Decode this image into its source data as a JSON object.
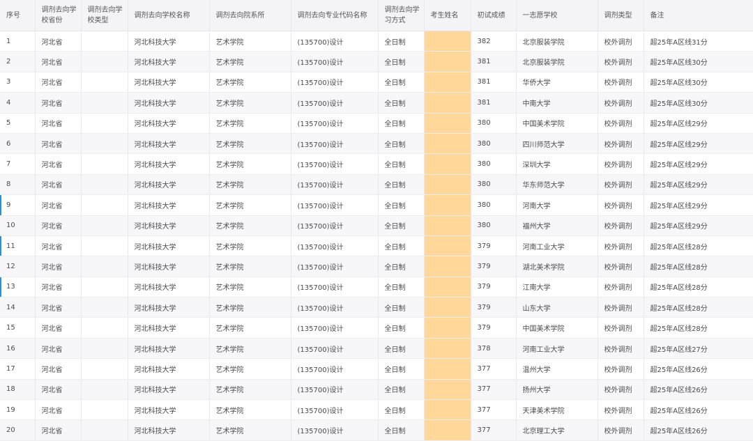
{
  "headers": {
    "idx": "序号",
    "province": "调剂去向学校省份",
    "school_type": "调剂去向学校类型",
    "school": "调剂去向学校名称",
    "dept": "调剂去向院系所",
    "major": "调剂去向专业代码名称",
    "mode": "调剂去向学习方式",
    "name": "考生姓名",
    "score": "初试成绩",
    "first_choice": "一志愿学校",
    "adjust_type": "调剂类型",
    "note": "备注"
  },
  "rows": [
    {
      "idx": "1",
      "province": "河北省",
      "school_type": "",
      "school": "河北科技大学",
      "dept": "艺术学院",
      "major": "(135700)设计",
      "mode": "全日制",
      "name": "",
      "score": "382",
      "first_choice": "北京服装学院",
      "adjust_type": "校外调剂",
      "note": "超25年A区线31分"
    },
    {
      "idx": "2",
      "province": "河北省",
      "school_type": "",
      "school": "河北科技大学",
      "dept": "艺术学院",
      "major": "(135700)设计",
      "mode": "全日制",
      "name": "",
      "score": "381",
      "first_choice": "北京服装学院",
      "adjust_type": "校外调剂",
      "note": "超25年A区线30分"
    },
    {
      "idx": "3",
      "province": "河北省",
      "school_type": "",
      "school": "河北科技大学",
      "dept": "艺术学院",
      "major": "(135700)设计",
      "mode": "全日制",
      "name": "",
      "score": "381",
      "first_choice": "华侨大学",
      "adjust_type": "校外调剂",
      "note": "超25年A区线30分"
    },
    {
      "idx": "4",
      "province": "河北省",
      "school_type": "",
      "school": "河北科技大学",
      "dept": "艺术学院",
      "major": "(135700)设计",
      "mode": "全日制",
      "name": "",
      "score": "381",
      "first_choice": "中南大学",
      "adjust_type": "校外调剂",
      "note": "超25年A区线30分"
    },
    {
      "idx": "5",
      "province": "河北省",
      "school_type": "",
      "school": "河北科技大学",
      "dept": "艺术学院",
      "major": "(135700)设计",
      "mode": "全日制",
      "name": "",
      "score": "380",
      "first_choice": "中国美术学院",
      "adjust_type": "校外调剂",
      "note": "超25年A区线29分"
    },
    {
      "idx": "6",
      "province": "河北省",
      "school_type": "",
      "school": "河北科技大学",
      "dept": "艺术学院",
      "major": "(135700)设计",
      "mode": "全日制",
      "name": "",
      "score": "380",
      "first_choice": "四川师范大学",
      "adjust_type": "校外调剂",
      "note": "超25年A区线29分"
    },
    {
      "idx": "7",
      "province": "河北省",
      "school_type": "",
      "school": "河北科技大学",
      "dept": "艺术学院",
      "major": "(135700)设计",
      "mode": "全日制",
      "name": "",
      "score": "380",
      "first_choice": "深圳大学",
      "adjust_type": "校外调剂",
      "note": "超25年A区线29分"
    },
    {
      "idx": "8",
      "province": "河北省",
      "school_type": "",
      "school": "河北科技大学",
      "dept": "艺术学院",
      "major": "(135700)设计",
      "mode": "全日制",
      "name": "",
      "score": "380",
      "first_choice": "华东师范大学",
      "adjust_type": "校外调剂",
      "note": "超25年A区线29分"
    },
    {
      "idx": "9",
      "province": "河北省",
      "school_type": "",
      "school": "河北科技大学",
      "dept": "艺术学院",
      "major": "(135700)设计",
      "mode": "全日制",
      "name": "",
      "score": "380",
      "first_choice": "河南大学",
      "adjust_type": "校外调剂",
      "note": "超25年A区线29分",
      "marked": true
    },
    {
      "idx": "10",
      "province": "河北省",
      "school_type": "",
      "school": "河北科技大学",
      "dept": "艺术学院",
      "major": "(135700)设计",
      "mode": "全日制",
      "name": "",
      "score": "380",
      "first_choice": "福州大学",
      "adjust_type": "校外调剂",
      "note": "超25年A区线29分"
    },
    {
      "idx": "11",
      "province": "河北省",
      "school_type": "",
      "school": "河北科技大学",
      "dept": "艺术学院",
      "major": "(135700)设计",
      "mode": "全日制",
      "name": "",
      "score": "379",
      "first_choice": "河南工业大学",
      "adjust_type": "校外调剂",
      "note": "超25年A区线28分",
      "marked": true
    },
    {
      "idx": "12",
      "province": "河北省",
      "school_type": "",
      "school": "河北科技大学",
      "dept": "艺术学院",
      "major": "(135700)设计",
      "mode": "全日制",
      "name": "",
      "score": "379",
      "first_choice": "湖北美术学院",
      "adjust_type": "校外调剂",
      "note": "超25年A区线28分"
    },
    {
      "idx": "13",
      "province": "河北省",
      "school_type": "",
      "school": "河北科技大学",
      "dept": "艺术学院",
      "major": "(135700)设计",
      "mode": "全日制",
      "name": "",
      "score": "379",
      "first_choice": "江南大学",
      "adjust_type": "校外调剂",
      "note": "超25年A区线28分",
      "marked": true
    },
    {
      "idx": "14",
      "province": "河北省",
      "school_type": "",
      "school": "河北科技大学",
      "dept": "艺术学院",
      "major": "(135700)设计",
      "mode": "全日制",
      "name": "",
      "score": "379",
      "first_choice": "山东大学",
      "adjust_type": "校外调剂",
      "note": "超25年A区线28分"
    },
    {
      "idx": "15",
      "province": "河北省",
      "school_type": "",
      "school": "河北科技大学",
      "dept": "艺术学院",
      "major": "(135700)设计",
      "mode": "全日制",
      "name": "",
      "score": "379",
      "first_choice": "中国美术学院",
      "adjust_type": "校外调剂",
      "note": "超25年A区线28分"
    },
    {
      "idx": "16",
      "province": "河北省",
      "school_type": "",
      "school": "河北科技大学",
      "dept": "艺术学院",
      "major": "(135700)设计",
      "mode": "全日制",
      "name": "",
      "score": "378",
      "first_choice": "河南工业大学",
      "adjust_type": "校外调剂",
      "note": "超25年A区线27分"
    },
    {
      "idx": "17",
      "province": "河北省",
      "school_type": "",
      "school": "河北科技大学",
      "dept": "艺术学院",
      "major": "(135700)设计",
      "mode": "全日制",
      "name": "",
      "score": "377",
      "first_choice": "温州大学",
      "adjust_type": "校外调剂",
      "note": "超25年A区线26分"
    },
    {
      "idx": "18",
      "province": "河北省",
      "school_type": "",
      "school": "河北科技大学",
      "dept": "艺术学院",
      "major": "(135700)设计",
      "mode": "全日制",
      "name": "",
      "score": "377",
      "first_choice": "扬州大学",
      "adjust_type": "校外调剂",
      "note": "超25年A区线26分"
    },
    {
      "idx": "19",
      "province": "河北省",
      "school_type": "",
      "school": "河北科技大学",
      "dept": "艺术学院",
      "major": "(135700)设计",
      "mode": "全日制",
      "name": "",
      "score": "377",
      "first_choice": "天津美术学院",
      "adjust_type": "校外调剂",
      "note": "超25年A区线26分"
    },
    {
      "idx": "20",
      "province": "河北省",
      "school_type": "",
      "school": "河北科技大学",
      "dept": "艺术学院",
      "major": "(135700)设计",
      "mode": "全日制",
      "name": "",
      "score": "377",
      "first_choice": "北京理工大学",
      "adjust_type": "校外调剂",
      "note": "超25年A区线26分"
    }
  ],
  "colors": {
    "name_column_fill": "#ffd798",
    "row_marker": "#2e8fd6"
  }
}
